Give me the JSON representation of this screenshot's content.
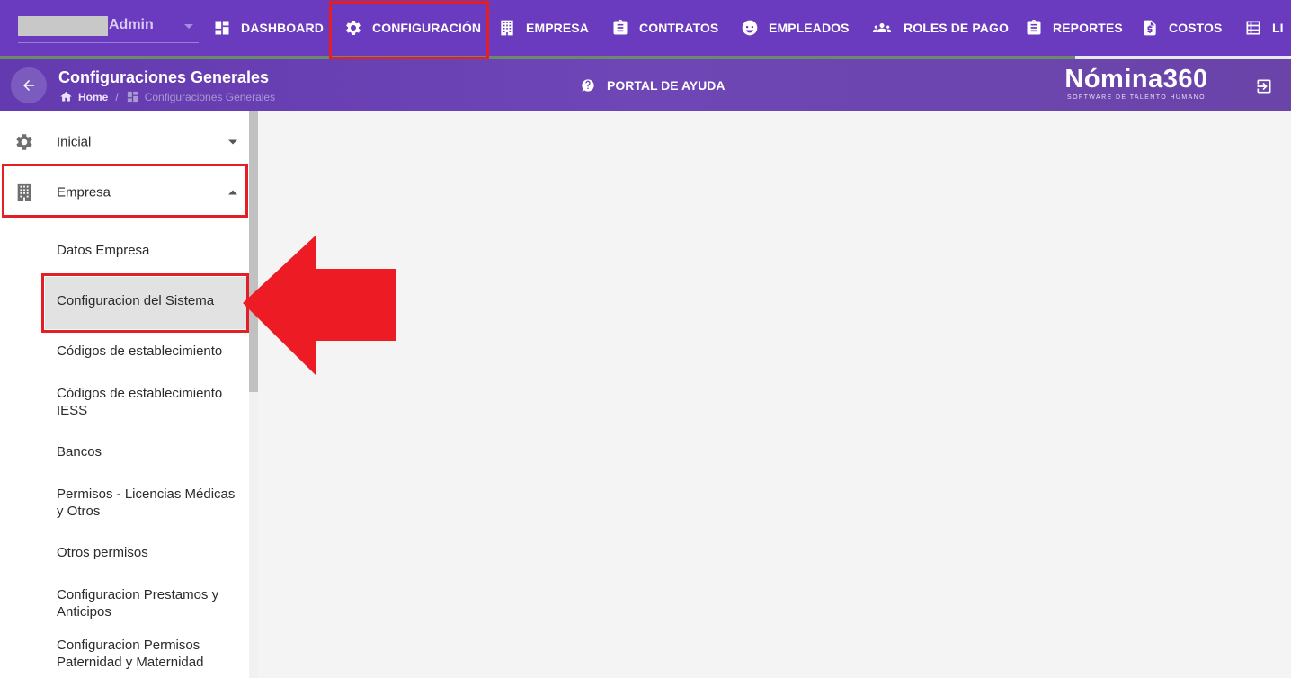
{
  "topnav": {
    "user": {
      "name": "Admin"
    },
    "items": [
      {
        "label": "DASHBOARD",
        "icon": "dashboard-icon"
      },
      {
        "label": "CONFIGURACIÓN",
        "icon": "gear-icon"
      },
      {
        "label": "EMPRESA",
        "icon": "building-icon"
      },
      {
        "label": "CONTRATOS",
        "icon": "clipboard-icon"
      },
      {
        "label": "EMPLEADOS",
        "icon": "face-icon"
      },
      {
        "label": "ROLES DE PAGO",
        "icon": "people-icon"
      },
      {
        "label": "REPORTES",
        "icon": "clipboard-list-icon"
      },
      {
        "label": "COSTOS",
        "icon": "dollar-document-icon"
      },
      {
        "label": "LI",
        "icon": "list-icon"
      }
    ],
    "progress_fraction": 0.833
  },
  "header": {
    "title": "Configuraciones Generales",
    "breadcrumb": {
      "home": "Home",
      "separator": "/",
      "current": "Configuraciones Generales"
    },
    "help_label": "PORTAL DE AYUDA",
    "brand": {
      "logo": "Nómina360",
      "tagline": "SOFTWARE DE TALENTO HUMANO"
    }
  },
  "sidebar": {
    "sections": [
      {
        "label": "Inicial",
        "icon": "gear-icon",
        "expanded": false
      },
      {
        "label": "Empresa",
        "icon": "building-icon",
        "expanded": true
      }
    ],
    "empresa_items": [
      "Datos Empresa",
      "Configuracion del Sistema",
      "Códigos de establecimiento",
      "Códigos de establecimiento IESS",
      "Bancos",
      "Permisos - Licencias Médicas y Otros",
      "Otros permisos",
      "Configuracion Prestamos y Anticipos",
      "Configuracion Permisos Paternidad y Maternidad"
    ],
    "selected_item": "Configuracion del Sistema"
  },
  "colors": {
    "nav_purple": "#6a3bbf",
    "highlight_red": "#e31e25",
    "selected_bg": "#e2e2e2",
    "content_bg": "#f4f4f4"
  }
}
